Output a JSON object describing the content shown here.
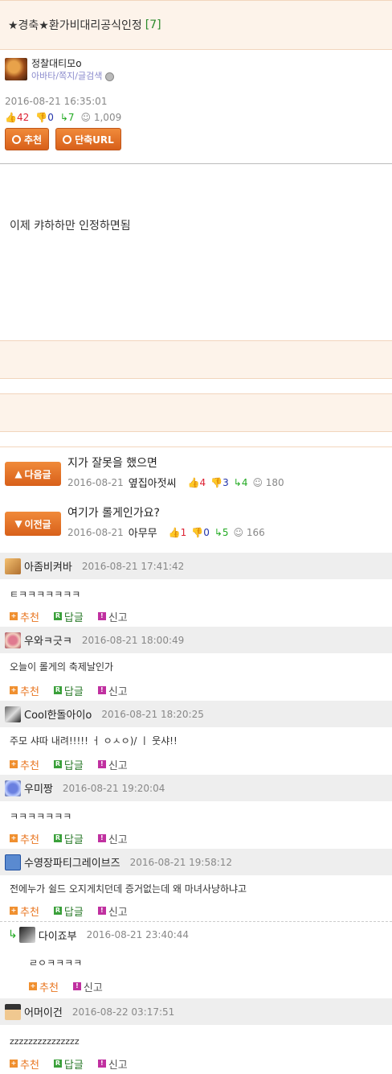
{
  "post": {
    "title": "★경축★환가비대리공식인정",
    "comment_count": "[7]",
    "author": "정찰대티모o",
    "author_links": "아바타/쪽지/글검색",
    "date": "2016-08-21 16:35:01",
    "up": "42",
    "down": "0",
    "share": "7",
    "views": "1,009",
    "recommend_label": "추천",
    "short_url_label": "단축URL",
    "content": "이제 캬하하만 인정하면됨"
  },
  "nav": {
    "next": {
      "label": "다음글",
      "title": "지가 잘못을 했으면",
      "date": "2016-08-21",
      "author": "옆집아젓씨",
      "up": "4",
      "down": "3",
      "share": "4",
      "views": "180"
    },
    "prev": {
      "label": "이전글",
      "title": "여기가 롤게인가요?",
      "date": "2016-08-21",
      "author": "아무무",
      "up": "1",
      "down": "0",
      "share": "5",
      "views": "166"
    }
  },
  "actions": {
    "recommend": "추천",
    "reply": "답글",
    "report": "신고"
  },
  "comments": [
    {
      "author": "아좀비켜바",
      "date": "2016-08-21 17:41:42",
      "text": "ㅌㅋㅋㅋㅋㅋㅋㅋ"
    },
    {
      "author": "우와ㅋ긋ㅋ",
      "date": "2016-08-21 18:00:49",
      "text": "오늘이 롤게의 축제날인가"
    },
    {
      "author": "Cool한돌아이o",
      "date": "2016-08-21 18:20:25",
      "text": "주모 샤따 내려!!!!! ㅓ ㅇㅅㅇ)/  ㅣ  웃샤!!"
    },
    {
      "author": "우미짱",
      "date": "2016-08-21 19:20:04",
      "text": "ㅋㅋㅋㅋㅋㅋㅋ"
    },
    {
      "author": "수영장파티그레이브즈",
      "date": "2016-08-21 19:58:12",
      "text": "전에누가 쉴드 오지게치던데 증거없는데 왜 마녀사냥하냐고"
    },
    {
      "author": "다이죠부",
      "date": "2016-08-21 23:40:44",
      "text": "ㄹㅇㅋㅋㅋㅋ"
    },
    {
      "author": "어머이건",
      "date": "2016-08-22 03:17:51",
      "text": "zzzzzzzzzzzzzzz"
    }
  ],
  "colors": {
    "accent": "#e8741e",
    "band": "#fdf3ea",
    "comment_head": "#eeeeee"
  }
}
